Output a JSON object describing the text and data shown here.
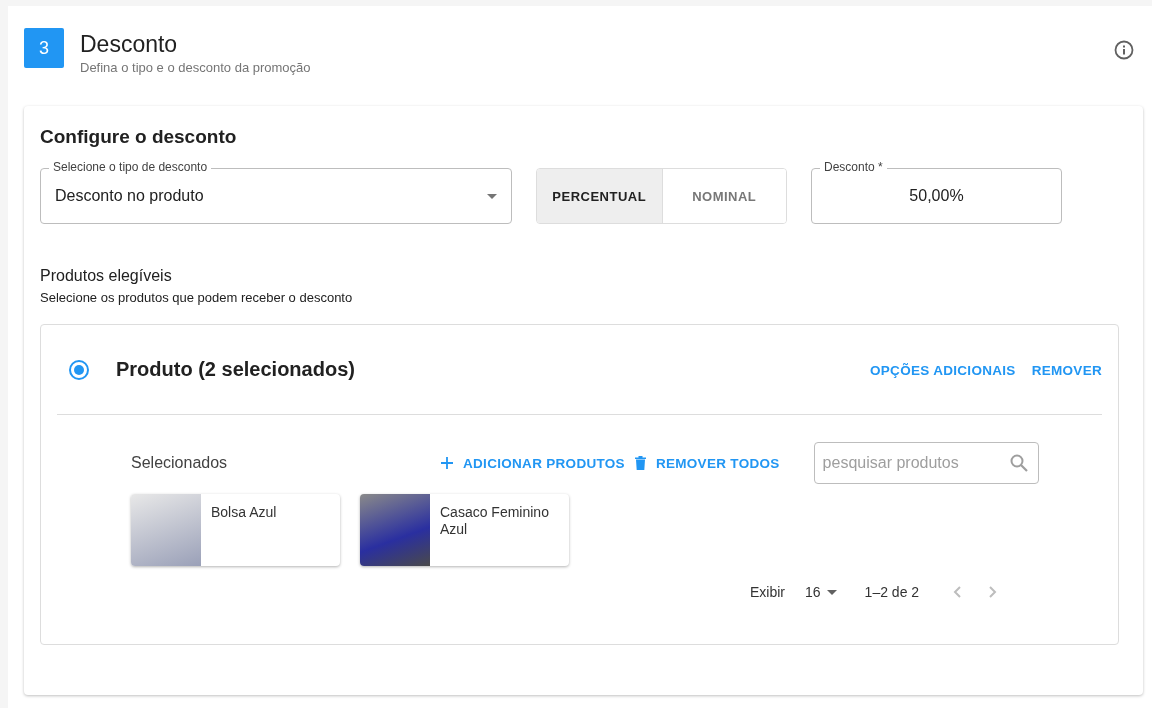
{
  "step": {
    "number": "3",
    "title": "Desconto",
    "subtitle": "Defina o tipo e o desconto da promoção"
  },
  "config": {
    "title": "Configure o desconto",
    "discount_type": {
      "label": "Selecione o tipo de desconto",
      "value": "Desconto no produto"
    },
    "mode_options": [
      {
        "label": "PERCENTUAL",
        "selected": true
      },
      {
        "label": "NOMINAL",
        "selected": false
      }
    ],
    "discount": {
      "label": "Desconto *",
      "value": "50,00%"
    }
  },
  "eligible": {
    "title": "Produtos elegíveis",
    "subtitle": "Selecione os produtos que podem receber o desconto"
  },
  "product_panel": {
    "selected": true,
    "title": "Produto (2 selecionados)",
    "actions": [
      "OPÇÕES ADICIONAIS",
      "REMOVER"
    ],
    "selected_label": "Selecionados",
    "buttons": [
      {
        "kind": "add",
        "label": "ADICIONAR PRODUTOS"
      },
      {
        "kind": "delete",
        "label": "REMOVER TODOS"
      }
    ],
    "search": {
      "placeholder": "pesquisar produtos"
    },
    "products": [
      {
        "name": "Bolsa Azul"
      },
      {
        "name": "Casaco Feminino Azul"
      }
    ],
    "pagination": {
      "label": "Exibir",
      "per_page": "16",
      "range": "1–2 de 2"
    }
  }
}
